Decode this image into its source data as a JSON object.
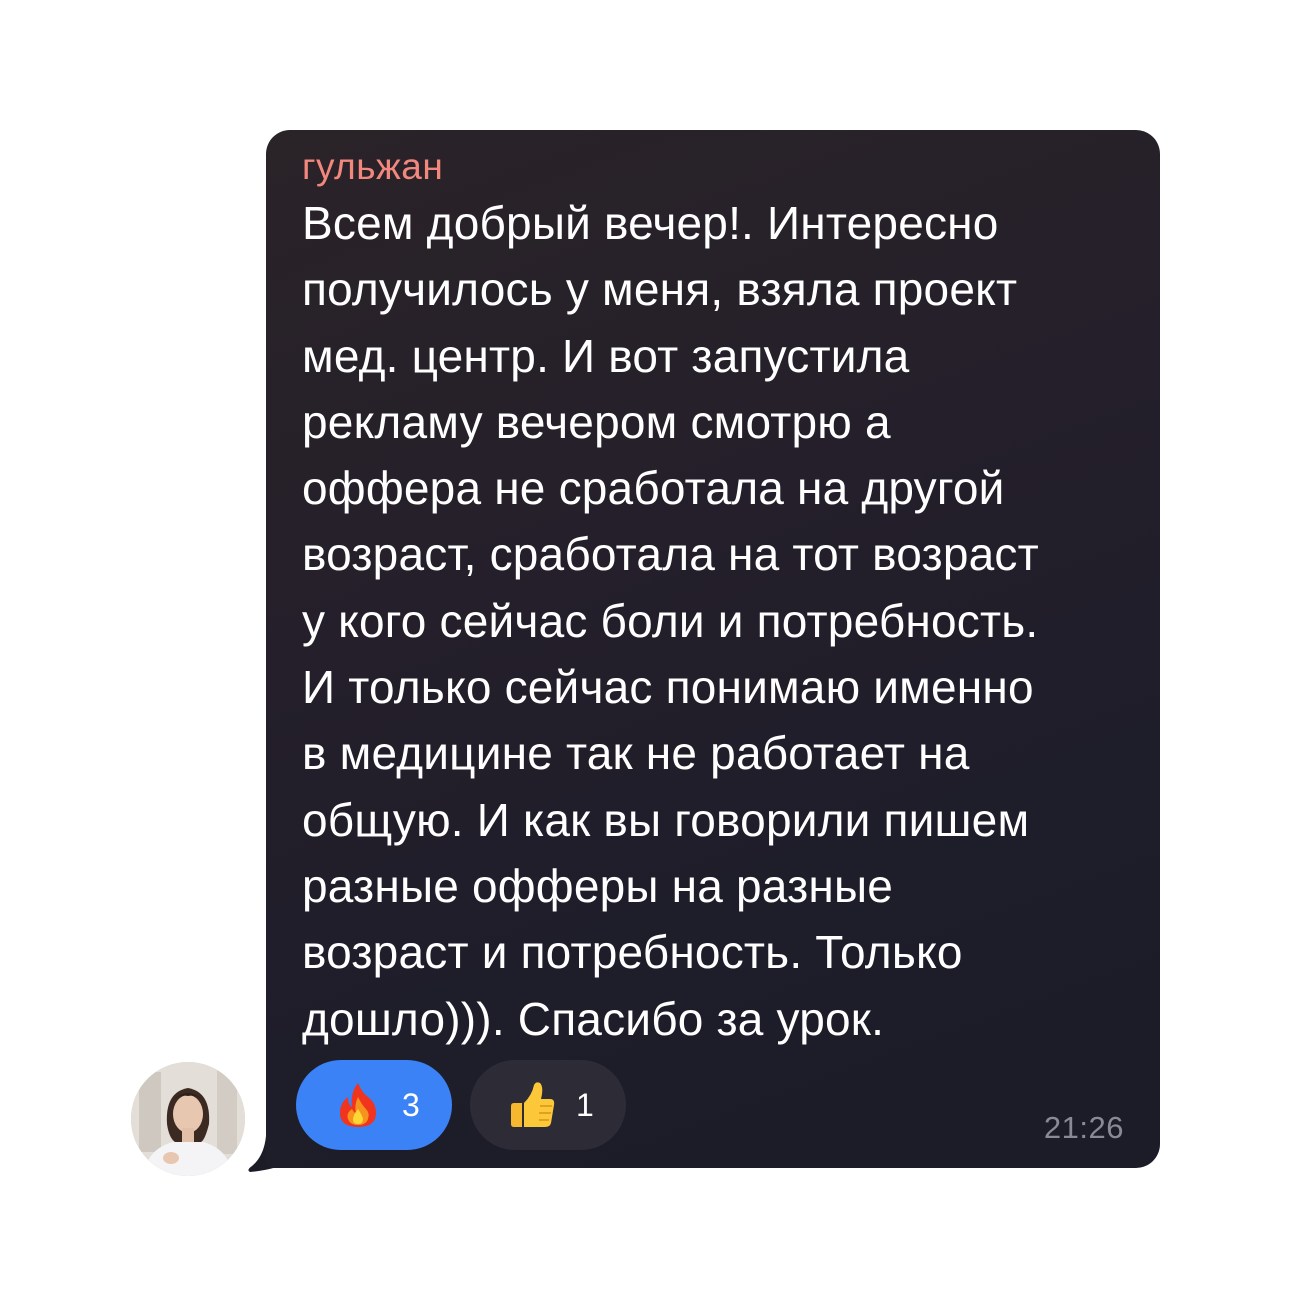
{
  "message": {
    "sender": "гульжан",
    "text": "Всем добрый вечер!. Интересно\nполучилось у меня, взяла проект\nмед. центр. И вот запустила\nрекламу вечером смотрю а\nоффера не сработала на другой\nвозраст, сработала на тот возраст\nу кого сейчас боли и потребность.\nИ только сейчас понимаю именно\nв медицине так не работает на\nобщую. И как вы говорили пишем\nразные офферы на разные\nвозраст и потребность. Только\nдошло))). Спасибо за урок.",
    "time": "21:26"
  },
  "reactions": [
    {
      "icon": "fire-emoji",
      "count": "3",
      "selected": true
    },
    {
      "icon": "thumbs-up-emoji",
      "count": "1",
      "selected": false
    }
  ],
  "colors": {
    "sender": "#f2877e",
    "bubble": "#211e29",
    "reaction_selected": "#3b82f6",
    "reaction_default": "#2c2b36",
    "time": "#8a8a97"
  }
}
